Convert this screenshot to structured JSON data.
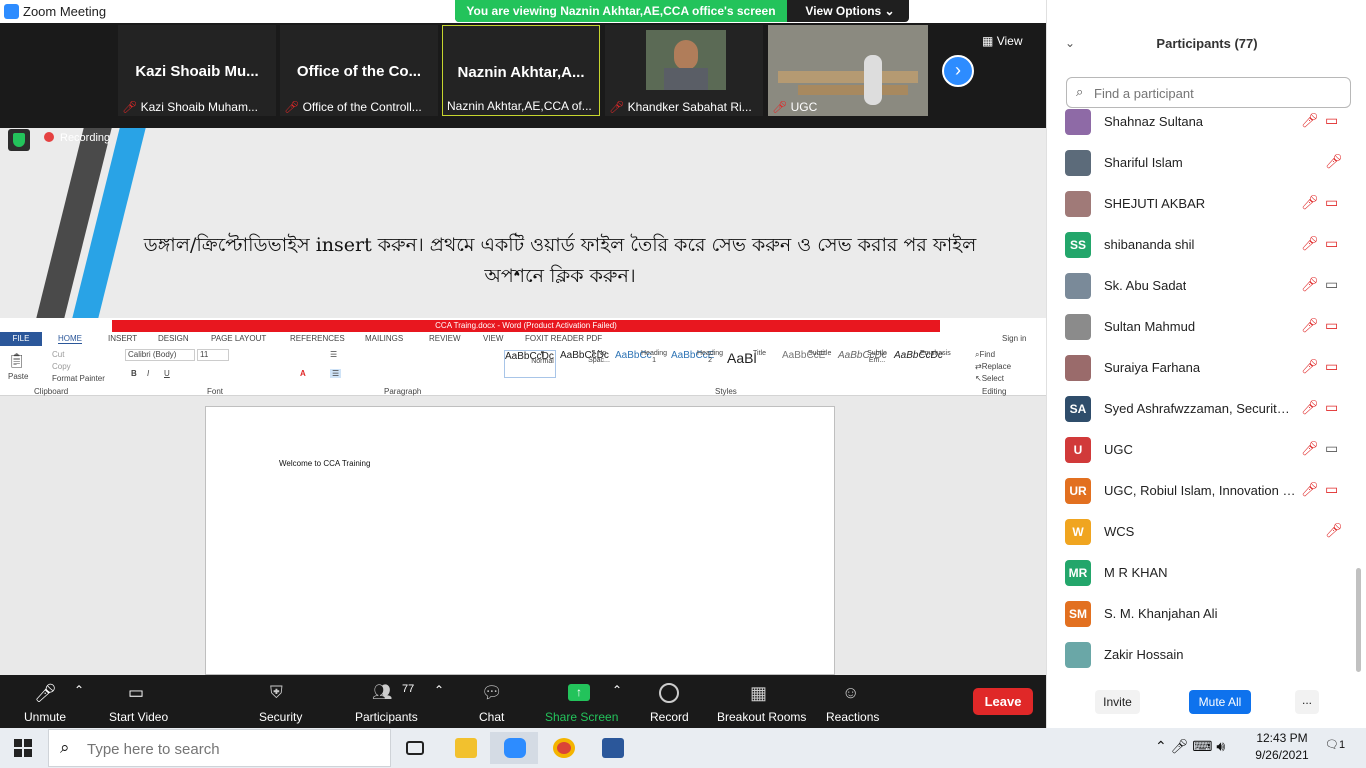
{
  "window": {
    "title": "Zoom Meeting",
    "controls": {
      "minimize": "—",
      "restore": "❐",
      "close": "✕"
    }
  },
  "banner": {
    "message": "You are viewing Naznin Akhtar,AE,CCA office's screen",
    "view_options": "View Options ⌄"
  },
  "strip": {
    "tiles": [
      {
        "name": "Kazi Shoaib Mu...",
        "label": "Kazi Shoaib Muham..."
      },
      {
        "name": "Office of the Co...",
        "label": "Office of the Controll..."
      },
      {
        "name": "Naznin Akhtar,A...",
        "label": "Naznin Akhtar,AE,CCA of..."
      },
      {
        "name": "",
        "label": "Khandker Sabahat Ri..."
      },
      {
        "name": "",
        "label": "UGC"
      }
    ],
    "view_label": "View",
    "next_icon": "›"
  },
  "shared": {
    "recording_label": "Recording",
    "slide_text": "ডঙ্গাল/ক্রিপ্টোডিভাইস insert করুন। প্রথমে একটি ওয়ার্ড ফাইল তৈরি করে সেভ করুন ও সেভ করার পর ফাইল অপশনে ক্লিক করুন।",
    "word": {
      "title": "CCA Traing.docx - Word (Product Activation Failed)",
      "tabs": [
        "FILE",
        "HOME",
        "INSERT",
        "DESIGN",
        "PAGE LAYOUT",
        "REFERENCES",
        "MAILINGS",
        "REVIEW",
        "VIEW",
        "FOXIT READER PDF"
      ],
      "sign_in": "Sign in",
      "clipboard": {
        "paste": "Paste",
        "cut": "Cut",
        "copy": "Copy",
        "format_painter": "Format Painter",
        "group": "Clipboard"
      },
      "font": {
        "name": "Calibri (Body)",
        "size": "11",
        "group": "Font"
      },
      "paragraph_group": "Paragraph",
      "styles": [
        {
          "preview": "AaBbCcDc",
          "name": "¶ Normal"
        },
        {
          "preview": "AaBbCcDc",
          "name": "¶ No Spac..."
        },
        {
          "preview": "AaBbCc",
          "name": "Heading 1"
        },
        {
          "preview": "AaBbCcE",
          "name": "Heading 2"
        },
        {
          "preview": "AaBl",
          "name": "Title"
        },
        {
          "preview": "AaBbCcE",
          "name": "Subtitle"
        },
        {
          "preview": "AaBbCcDc",
          "name": "Subtle Em..."
        },
        {
          "preview": "AaBbCcDc",
          "name": "Emphasis"
        }
      ],
      "styles_group": "Styles",
      "editing": {
        "find": "Find",
        "replace": "Replace",
        "select": "Select",
        "group": "Editing"
      },
      "document_text": "Welcome to CCA Training"
    }
  },
  "toolbar": {
    "unmute": "Unmute",
    "start_video": "Start Video",
    "security": "Security",
    "participants": "Participants",
    "participants_count": "77",
    "chat": "Chat",
    "share_screen": "Share Screen",
    "record": "Record",
    "breakout_rooms": "Breakout Rooms",
    "reactions": "Reactions",
    "leave": "Leave"
  },
  "participants_panel": {
    "title": "Participants (77)",
    "search_placeholder": "Find a participant",
    "list": [
      {
        "name": "Shahnaz Sultana",
        "initials": "",
        "avatar_color": "#8e6aa6",
        "video": "off"
      },
      {
        "name": "Shariful Islam",
        "initials": "",
        "avatar_color": "#5c6b7a",
        "video": "none"
      },
      {
        "name": "SHEJUTI AKBAR",
        "initials": "",
        "avatar_color": "#a07a78",
        "video": "off"
      },
      {
        "name": "shibananda shil",
        "initials": "SS",
        "avatar_color": "#23a66b",
        "video": "off"
      },
      {
        "name": "Sk. Abu Sadat",
        "initials": "",
        "avatar_color": "#7a8a99",
        "video": "on"
      },
      {
        "name": "Sultan Mahmud",
        "initials": "",
        "avatar_color": "#8b8b8b",
        "video": "off"
      },
      {
        "name": "Suraiya Farhana",
        "initials": "",
        "avatar_color": "#9a6b6b",
        "video": "off"
      },
      {
        "name": "Syed Ashrafwzzaman, Security ...",
        "initials": "SA",
        "avatar_color": "#2f4d6b",
        "video": "off"
      },
      {
        "name": "UGC",
        "initials": "U",
        "avatar_color": "#d13a3a",
        "video": "on"
      },
      {
        "name": "UGC, Robiul Islam, Innovation F...",
        "initials": "UR",
        "avatar_color": "#e27020",
        "video": "off"
      },
      {
        "name": "WCS",
        "initials": "W",
        "avatar_color": "#f0a520",
        "video": "none"
      },
      {
        "name": "M R KHAN",
        "initials": "MR",
        "avatar_color": "#23a66b",
        "video": "hidden"
      },
      {
        "name": "S. M. Khanjahan Ali",
        "initials": "SM",
        "avatar_color": "#e27020",
        "video": "hidden"
      },
      {
        "name": "Zakir Hossain",
        "initials": "",
        "avatar_color": "#6aa7a7",
        "video": "hidden"
      }
    ],
    "invite": "Invite",
    "mute_all": "Mute All",
    "more": "..."
  },
  "taskbar": {
    "search_placeholder": "Type here to search",
    "time": "12:43 PM",
    "date": "9/26/2021",
    "notifications": "1"
  },
  "colors": {
    "zoom_blue": "#2d8cff",
    "green": "#23c35b",
    "red": "#e02828",
    "word_blue": "#2b579a"
  }
}
